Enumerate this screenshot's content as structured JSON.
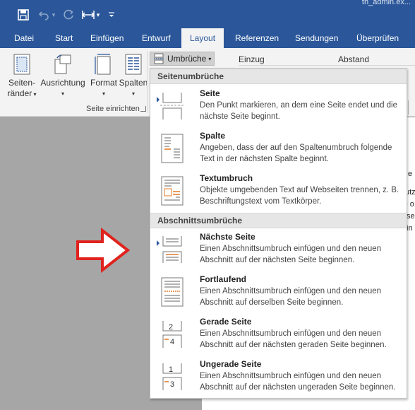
{
  "titlebar": {
    "save_icon": "save-icon",
    "undo_icon": "undo-icon",
    "redo_icon": "redo-icon",
    "customize_icon": "customize-qat-icon",
    "title_text": "th_admin.ex..."
  },
  "tabs": [
    {
      "label": "Datei"
    },
    {
      "label": "Start"
    },
    {
      "label": "Einfügen"
    },
    {
      "label": "Entwurf"
    },
    {
      "label": "Layout"
    },
    {
      "label": "Referenzen"
    },
    {
      "label": "Sendungen"
    },
    {
      "label": "Überprüfen"
    }
  ],
  "active_tab": "Layout",
  "ribbon": {
    "seitenraender": {
      "line1": "Seiten-",
      "line2": "ränder"
    },
    "ausrichtung": {
      "label": "Ausrichtung"
    },
    "format": {
      "label": "Format"
    },
    "spalten": {
      "label": "Spalten"
    },
    "group_label": "Seite einrichten",
    "umbrueche": {
      "label": "Umbrüche"
    },
    "einzug": "Einzug",
    "abstand": "Abstand"
  },
  "menu": {
    "section1": "Seitenumbrüche",
    "section2": "Abschnittsumbrüche",
    "items": [
      {
        "title": "Seite",
        "desc": "Den Punkt markieren, an dem eine Seite endet und die nächste Seite beginnt.",
        "icon": "page-break-icon"
      },
      {
        "title": "Spalte",
        "desc": "Angeben, dass der auf den Spaltenumbruch folgende Text in der nächsten Spalte beginnt.",
        "icon": "column-break-icon"
      },
      {
        "title": "Textumbruch",
        "desc": "Objekte umgebenden Text auf Webseiten trennen, z. B. Beschriftungstext vom Textkörper.",
        "icon": "text-wrapping-break-icon"
      },
      {
        "title": "Nächste Seite",
        "desc": "Einen Abschnittsumbruch einfügen und den neuen Abschnitt auf der nächsten Seite beginnen.",
        "icon": "next-page-section-icon"
      },
      {
        "title": "Fortlaufend",
        "desc": "Einen Abschnittsumbruch einfügen und den neuen Abschnitt auf derselben Seite beginnen.",
        "icon": "continuous-section-icon"
      },
      {
        "title": "Gerade Seite",
        "desc": "Einen Abschnittsumbruch einfügen und den neuen Abschnitt auf der nächsten geraden Seite beginnen.",
        "icon": "even-page-section-icon"
      },
      {
        "title": "Ungerade Seite",
        "desc": "Einen Abschnittsumbruch einfügen und den neuen Abschnitt auf der nächsten ungeraden Seite beginnen.",
        "icon": "odd-page-section-icon"
      }
    ]
  },
  "page_fragments": [
    "e",
    "utz",
    "- o",
    "se",
    "in"
  ],
  "colors": {
    "brand": "#2b579a",
    "arrow": "#e0231e",
    "break_line": "#e07b2a"
  }
}
